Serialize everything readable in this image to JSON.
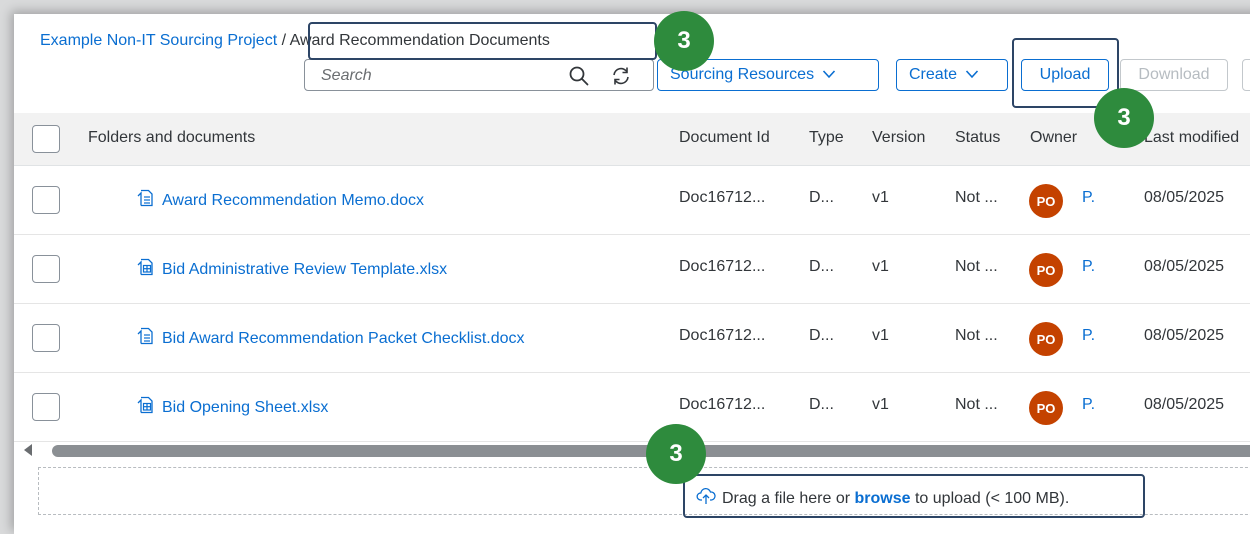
{
  "breadcrumb": {
    "project": "Example Non-IT Sourcing Project",
    "separator": " / ",
    "current": "Award Recommendation Documents"
  },
  "search": {
    "placeholder": "Search",
    "value": ""
  },
  "toolbar": {
    "sourcing_resources": "Sourcing Resources",
    "create": "Create",
    "upload": "Upload",
    "download": "Download"
  },
  "table": {
    "headers": {
      "name": "Folders and documents",
      "document_id": "Document Id",
      "type": "Type",
      "version": "Version",
      "status": "Status",
      "owner": "Owner",
      "last_modified": "Last modified"
    },
    "rows": [
      {
        "name": "Award Recommendation Memo.docx",
        "icon": "word-document-icon",
        "document_id": "Doc16712...",
        "type": "D...",
        "version": "v1",
        "status": "Not ...",
        "owner_initials": "PO",
        "owner": "P.",
        "last_modified": "08/05/2025"
      },
      {
        "name": "Bid Administrative Review Template.xlsx",
        "icon": "spreadsheet-document-icon",
        "document_id": "Doc16712...",
        "type": "D...",
        "version": "v1",
        "status": "Not ...",
        "owner_initials": "PO",
        "owner": "P.",
        "last_modified": "08/05/2025"
      },
      {
        "name": "Bid Award Recommendation Packet Checklist.docx",
        "icon": "word-document-icon",
        "document_id": "Doc16712...",
        "type": "D...",
        "version": "v1",
        "status": "Not ...",
        "owner_initials": "PO",
        "owner": "P.",
        "last_modified": "08/05/2025"
      },
      {
        "name": "Bid Opening Sheet.xlsx",
        "icon": "spreadsheet-document-icon",
        "document_id": "Doc16712...",
        "type": "D...",
        "version": "v1",
        "status": "Not ...",
        "owner_initials": "PO",
        "owner": "P.",
        "last_modified": "08/05/2025"
      }
    ]
  },
  "dropzone": {
    "prefix": "Drag a file here or ",
    "browse": "browse",
    "suffix": " to upload (< 100 MB)."
  },
  "annotations": {
    "step": "3"
  },
  "colors": {
    "link": "#0a6ed1",
    "avatar": "#c44200",
    "badge": "#2e8b3d",
    "highlight": "#2d4566"
  }
}
